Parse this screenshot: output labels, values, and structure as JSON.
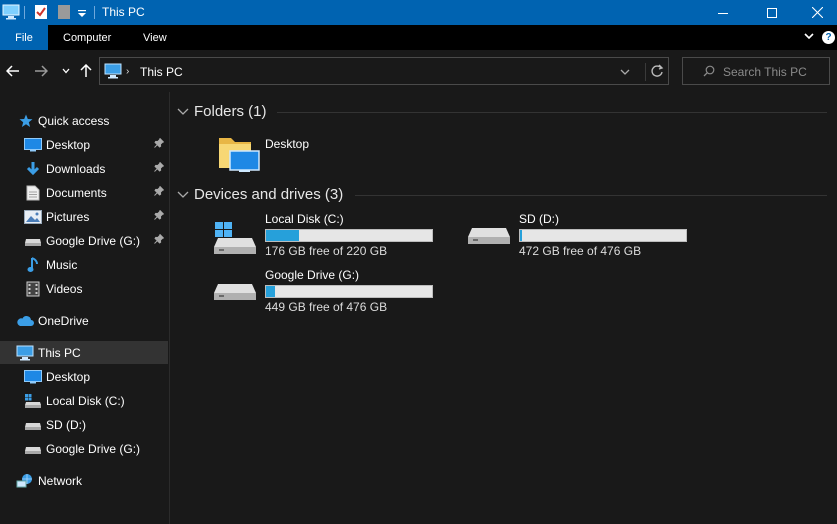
{
  "window": {
    "title": "This PC",
    "accent": "#0063b1"
  },
  "quick_access_toolbar": {
    "icons": [
      "this-pc-icon",
      "properties-icon",
      "new-folder-icon",
      "customize-dropdown-icon"
    ]
  },
  "window_controls": {
    "minimize_icon": "minimize-icon",
    "maximize_icon": "maximize-icon",
    "close_icon": "close-icon"
  },
  "ribbon": {
    "tabs": [
      {
        "label": "File"
      },
      {
        "label": "Computer"
      },
      {
        "label": "View"
      }
    ],
    "help": "?"
  },
  "address": {
    "path": "This PC",
    "search_placeholder": "Search This PC"
  },
  "nav_pane": {
    "quick_access": "Quick access",
    "quick_items": [
      {
        "label": "Desktop",
        "pinned": true
      },
      {
        "label": "Downloads",
        "pinned": true
      },
      {
        "label": "Documents",
        "pinned": true
      },
      {
        "label": "Pictures",
        "pinned": true
      },
      {
        "label": "Google Drive (G:)",
        "pinned": true
      },
      {
        "label": "Music",
        "pinned": false
      },
      {
        "label": "Videos",
        "pinned": false
      }
    ],
    "onedrive": "OneDrive",
    "this_pc": "This PC",
    "pc_items": [
      {
        "label": "Desktop"
      },
      {
        "label": "Local Disk (C:)"
      },
      {
        "label": "SD (D:)"
      },
      {
        "label": "Google Drive (G:)"
      }
    ],
    "network": "Network"
  },
  "content": {
    "folders_header": "Folders (1)",
    "folders": [
      {
        "name": "Desktop"
      }
    ],
    "drives_header": "Devices and drives (3)",
    "drives": [
      {
        "name": "Local Disk (C:)",
        "free_text": "176 GB free of 220 GB",
        "used_fraction": 0.2,
        "icon": "windows-drive-icon"
      },
      {
        "name": "SD (D:)",
        "free_text": "472 GB free of 476 GB",
        "used_fraction": 0.008,
        "icon": "drive-icon"
      },
      {
        "name": "Google Drive (G:)",
        "free_text": "449 GB free of 476 GB",
        "used_fraction": 0.057,
        "icon": "drive-icon"
      }
    ],
    "bar_color": "#26a0da"
  }
}
